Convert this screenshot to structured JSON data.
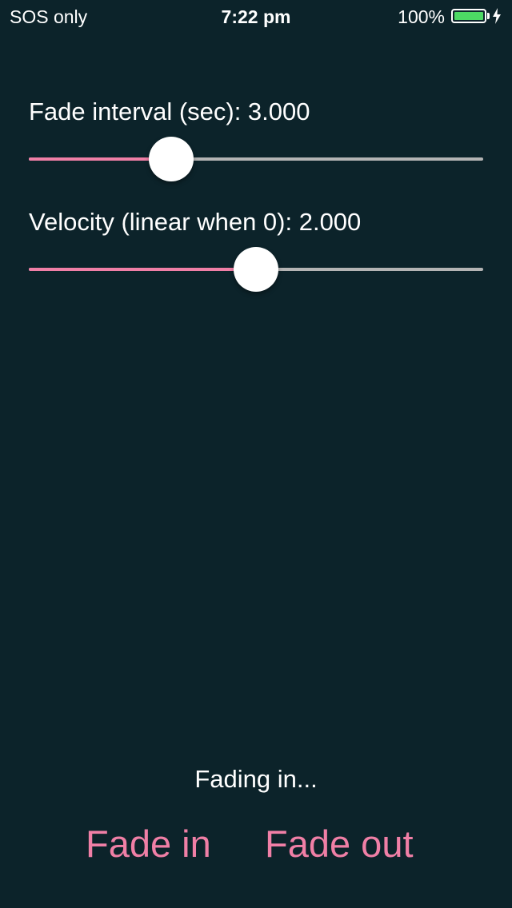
{
  "colors": {
    "background": "#0c232a",
    "accent": "#f07fa6",
    "track": "#b4b4b4",
    "battery": "#4cd964",
    "text": "#ffffff"
  },
  "status_bar": {
    "carrier": "SOS only",
    "time": "7:22 pm",
    "battery_percent": "100%",
    "battery_level": 1.0,
    "charging_icon": "bolt-icon"
  },
  "controls": {
    "fade_interval": {
      "label": "Fade interval (sec): 3.000",
      "value": 3.0,
      "fraction": 0.313
    },
    "velocity": {
      "label": "Velocity (linear when 0): 2.000",
      "value": 2.0,
      "fraction": 0.5
    }
  },
  "status_message": "Fading in...",
  "buttons": {
    "fade_in": "Fade in",
    "fade_out": "Fade out"
  }
}
